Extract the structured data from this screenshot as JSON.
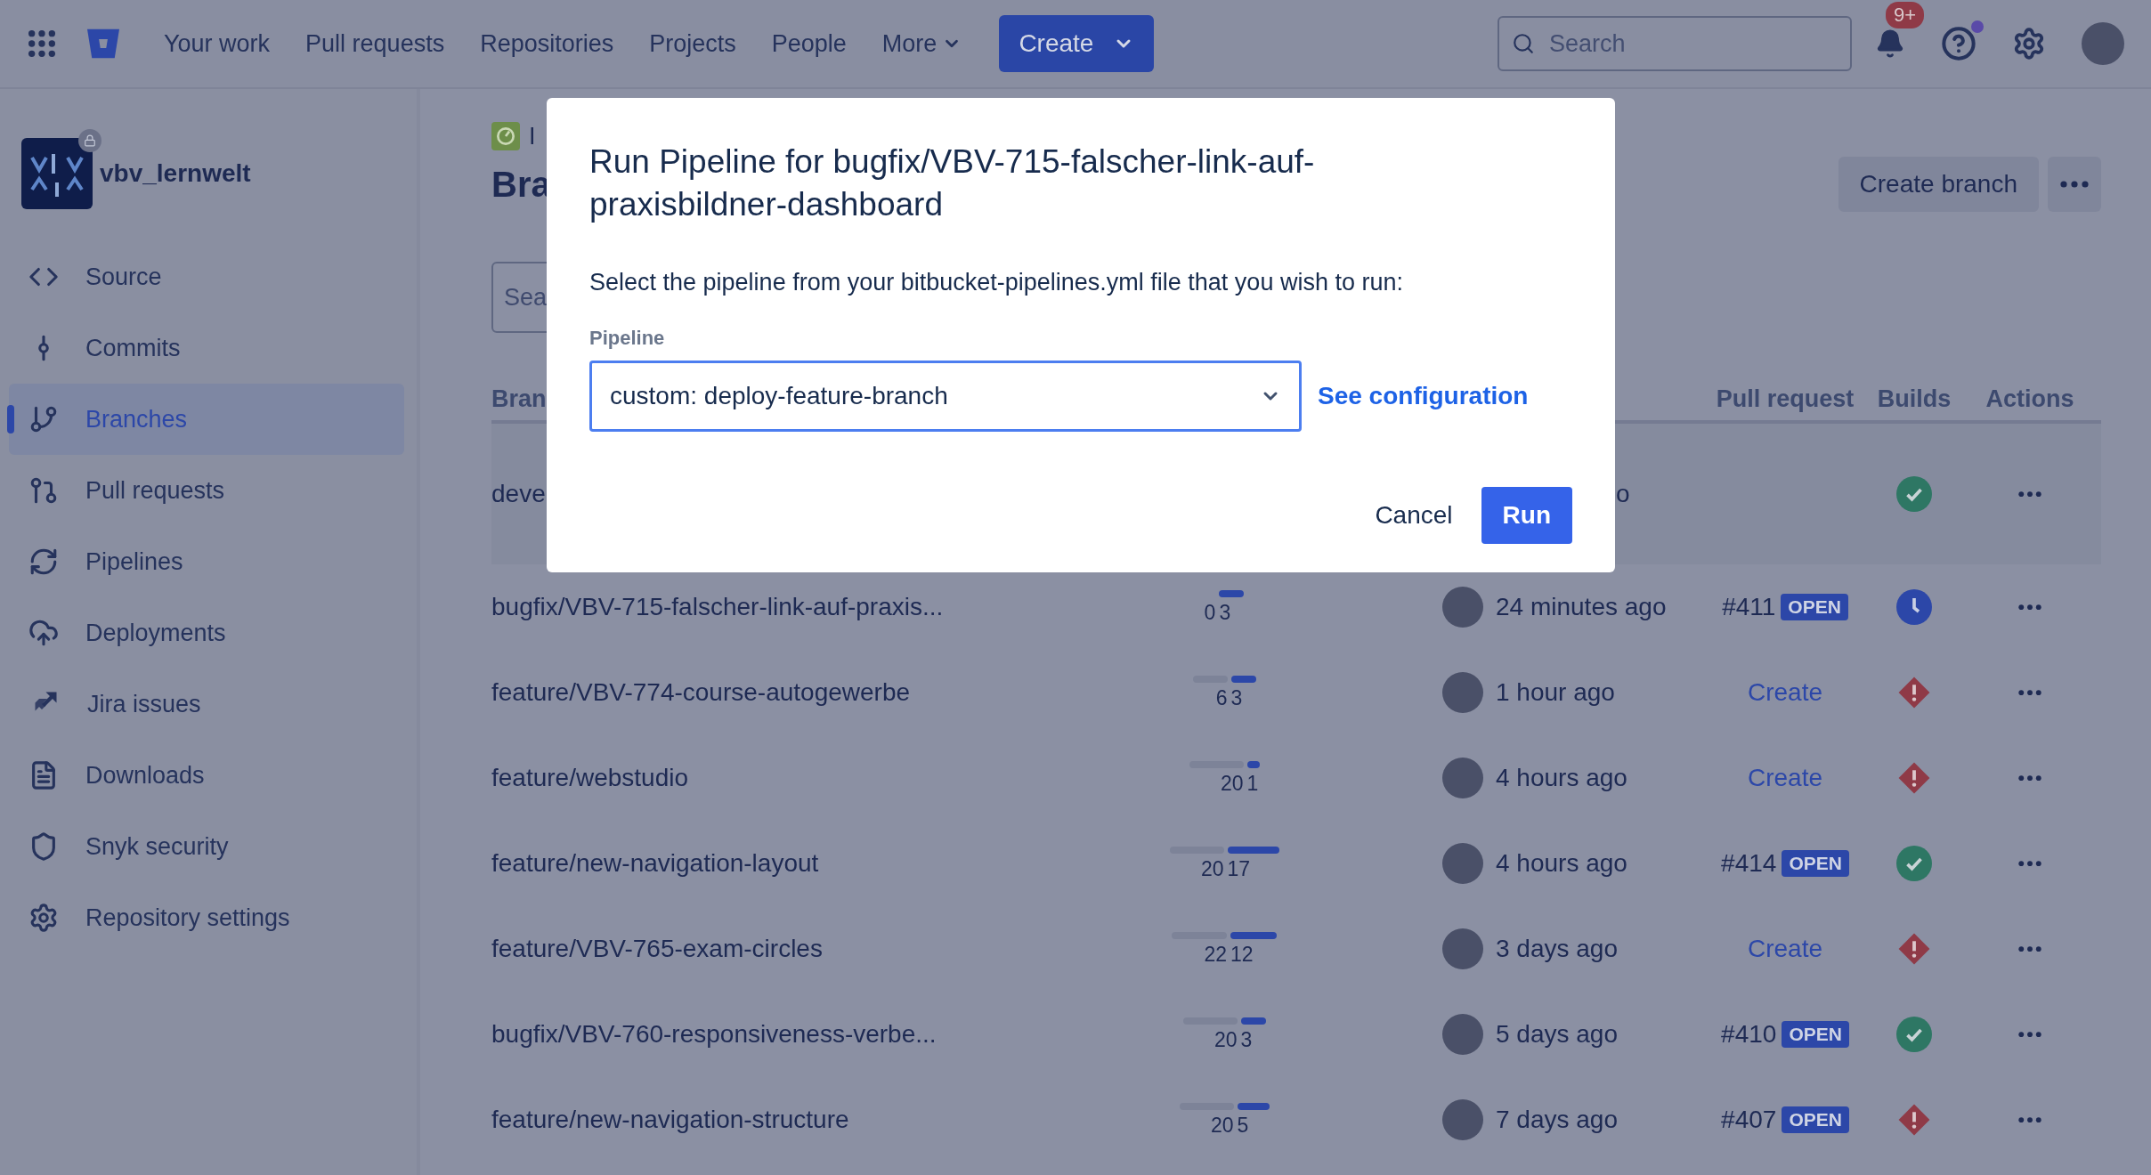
{
  "top_nav": {
    "links": [
      "Your work",
      "Pull requests",
      "Repositories",
      "Projects",
      "People"
    ],
    "more": "More",
    "create": "Create",
    "search": {
      "placeholder": "Search"
    },
    "notifications_badge": "9+"
  },
  "sidebar": {
    "repo_name": "vbv_lernwelt",
    "items": [
      {
        "label": "Source",
        "selected": false
      },
      {
        "label": "Commits",
        "selected": false
      },
      {
        "label": "Branches",
        "selected": true
      },
      {
        "label": "Pull requests",
        "selected": false
      },
      {
        "label": "Pipelines",
        "selected": false
      },
      {
        "label": "Deployments",
        "selected": false
      },
      {
        "label": "Jira issues",
        "selected": false
      },
      {
        "label": "Downloads",
        "selected": false
      },
      {
        "label": "Snyk security",
        "selected": false
      },
      {
        "label": "Repository settings",
        "selected": false
      }
    ]
  },
  "page": {
    "breadcrumb": "I",
    "title": "Bra",
    "search": {
      "placeholder": "Sea"
    },
    "create_branch": "Create branch"
  },
  "table": {
    "columns": [
      {
        "label": "Bran"
      },
      {
        "label": "Pull request"
      },
      {
        "label": "Builds"
      },
      {
        "label": "Actions"
      }
    ],
    "rows": [
      {
        "branch": "deve",
        "time": "o",
        "avatar": false,
        "build": {
          "kind": "success"
        },
        "selected": true
      },
      {
        "branch": "bugfix/VBV-715-falscher-link-auf-praxis...",
        "behind": "0",
        "ahead": "3",
        "avatar": true,
        "time": "24 minutes ago",
        "pr": {
          "kind": "open",
          "number": "#411",
          "badge": "OPEN"
        },
        "build": {
          "kind": "running"
        },
        "selected": false
      },
      {
        "branch": "feature/VBV-774-course-autogewerbe",
        "behind": "6",
        "ahead": "3",
        "avatar": true,
        "time": "1 hour ago",
        "pr": {
          "kind": "create",
          "label": "Create"
        },
        "build": {
          "kind": "failed"
        },
        "selected": false
      },
      {
        "branch": "feature/webstudio",
        "behind": "20",
        "ahead": "1",
        "avatar": true,
        "time": "4 hours ago",
        "pr": {
          "kind": "create",
          "label": "Create"
        },
        "build": {
          "kind": "failed"
        },
        "selected": false
      },
      {
        "branch": "feature/new-navigation-layout",
        "behind": "20",
        "ahead": "17",
        "avatar": true,
        "time": "4 hours ago",
        "pr": {
          "kind": "open",
          "number": "#414",
          "badge": "OPEN"
        },
        "build": {
          "kind": "success"
        },
        "selected": false
      },
      {
        "branch": "feature/VBV-765-exam-circles",
        "behind": "22",
        "ahead": "12",
        "avatar": true,
        "time": "3 days ago",
        "pr": {
          "kind": "create",
          "label": "Create"
        },
        "build": {
          "kind": "failed"
        },
        "selected": false
      },
      {
        "branch": "bugfix/VBV-760-responsiveness-verbe...",
        "behind": "20",
        "ahead": "3",
        "avatar": true,
        "time": "5 days ago",
        "pr": {
          "kind": "open",
          "number": "#410",
          "badge": "OPEN"
        },
        "build": {
          "kind": "success"
        },
        "selected": false
      },
      {
        "branch": "feature/new-navigation-structure",
        "behind": "20",
        "ahead": "5",
        "avatar": true,
        "time": "7 days ago",
        "pr": {
          "kind": "open",
          "number": "#407",
          "badge": "OPEN"
        },
        "build": {
          "kind": "failed"
        },
        "selected": false
      }
    ]
  },
  "dialog": {
    "title": "Run Pipeline for bugfix/VBV-715-falscher-link-auf-praxisbildner-dashboard",
    "description": "Select the pipeline from your bitbucket-pipelines.yml file that you wish to run:",
    "field_label": "Pipeline",
    "value": "custom: deploy-feature-branch",
    "link": "See configuration",
    "cancel": "Cancel",
    "run": "Run"
  }
}
